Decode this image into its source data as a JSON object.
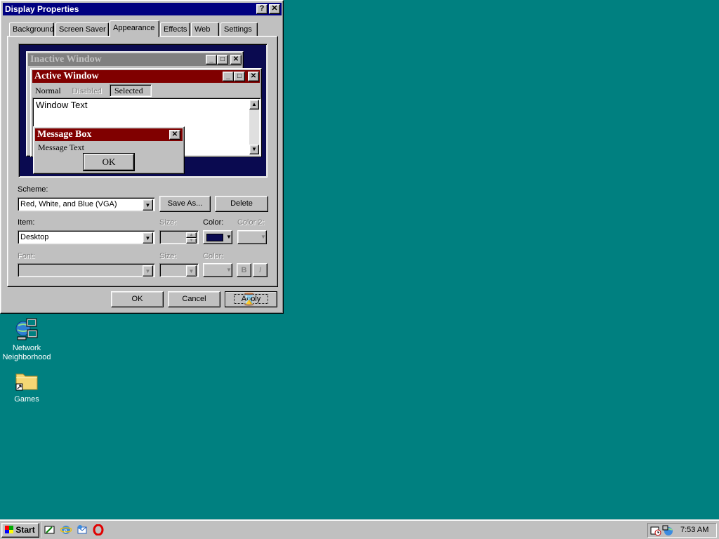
{
  "dialog": {
    "title": "Display Properties",
    "help_btn": "?",
    "close_btn": "✕",
    "tabs": [
      {
        "label": "Background"
      },
      {
        "label": "Screen Saver"
      },
      {
        "label": "Appearance"
      },
      {
        "label": "Effects"
      },
      {
        "label": "Web"
      },
      {
        "label": "Settings"
      }
    ],
    "preview": {
      "inactive_title": "Inactive Window",
      "active_title": "Active Window",
      "menu": {
        "normal": "Normal",
        "disabled": "Disabled",
        "selected": "Selected"
      },
      "window_text": "Window Text",
      "msgbox_title": "Message Box",
      "msgbox_text": "Message Text",
      "msgbox_ok": "OK",
      "min_glyph": "_",
      "max_glyph": "□",
      "close_glyph": "✕"
    },
    "scheme": {
      "label": "Scheme:",
      "value": "Red, White, and Blue (VGA)"
    },
    "save_as": "Save As...",
    "delete": "Delete",
    "item": {
      "label": "Item:",
      "value": "Desktop"
    },
    "size_label": "Size:",
    "color_label": "Color:",
    "color2_label": "Color 2:",
    "item_color": "#0a0a50",
    "font": {
      "label": "Font:"
    },
    "font_size_label": "Size:",
    "font_color_label": "Color:",
    "bold": "B",
    "italic": "I",
    "ok": "OK",
    "cancel": "Cancel",
    "apply": "Apply"
  },
  "desktop": {
    "icons": [
      {
        "label": "Network Neighborhood",
        "icon": "network-neighborhood-icon"
      },
      {
        "label": "Games",
        "icon": "folder-shortcut-icon"
      }
    ]
  },
  "taskbar": {
    "start": "Start",
    "quicklaunch": [
      "show-desktop-icon",
      "internet-explorer-icon",
      "outlook-express-icon",
      "opera-icon"
    ],
    "clock": "7:53 AM"
  },
  "colors": {
    "desktop": "#008080",
    "active_caption": "#800000",
    "inactive_caption": "#808080",
    "title_bar": "#000080"
  }
}
